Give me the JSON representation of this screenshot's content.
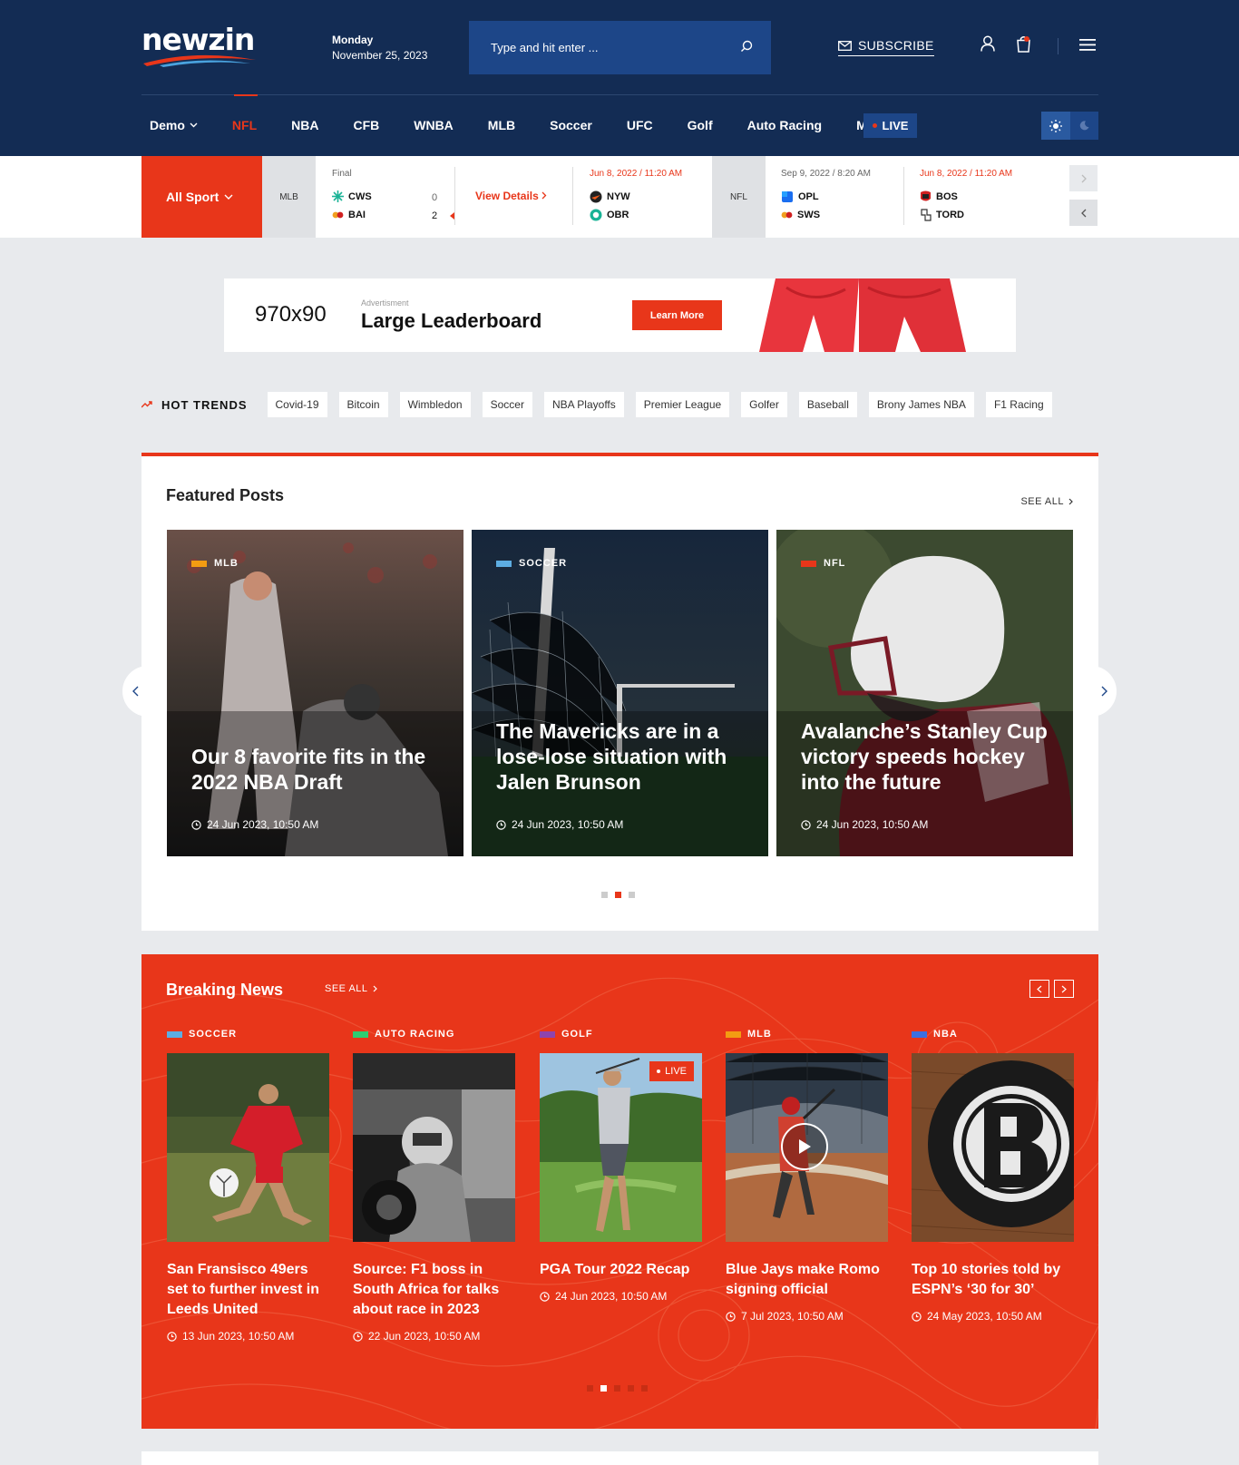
{
  "header": {
    "logo": "newzin",
    "date_day": "Monday",
    "date_full": "November 25, 2023",
    "search_placeholder": "Type and hit enter ...",
    "subscribe": "SUBSCRIBE",
    "nav": [
      {
        "label": "Demo",
        "dropdown": true
      },
      {
        "label": "NFL",
        "active": true
      },
      {
        "label": "NBA"
      },
      {
        "label": "CFB"
      },
      {
        "label": "WNBA"
      },
      {
        "label": "MLB"
      },
      {
        "label": "Soccer"
      },
      {
        "label": "UFC"
      },
      {
        "label": "Golf"
      },
      {
        "label": "Auto Racing"
      },
      {
        "label": "More"
      }
    ],
    "live": "LIVE"
  },
  "scores": {
    "all_sport": "All Sport",
    "league1": "MLB",
    "game1_status": "Final",
    "game1_team1": "CWS",
    "game1_score1": "0",
    "game1_team2": "BAI",
    "game1_score2": "2",
    "view_details": "View Details",
    "game2_time": "Jun 8, 2022 / 11:20 AM",
    "game2_team1": "NYW",
    "game2_team2": "OBR",
    "league2": "NFL",
    "game3_time": "Sep 9, 2022 / 8:20 AM",
    "game3_team1": "OPL",
    "game3_team2": "SWS",
    "game4_time": "Jun 8, 2022 / 11:20 AM",
    "game4_team1": "BOS",
    "game4_team2": "TORD"
  },
  "ad": {
    "size": "970x90",
    "label": "Advertisment",
    "title": "Large Leaderboard",
    "button": "Learn More"
  },
  "trends": {
    "label": "HOT TRENDS",
    "tags": [
      "Covid-19",
      "Bitcoin",
      "Wimbledon",
      "Soccer",
      "NBA Playoffs",
      "Premier League",
      "Golfer",
      "Baseball",
      "Brony James NBA",
      "F1 Racing"
    ]
  },
  "featured": {
    "title": "Featured Posts",
    "see_all": "SEE ALL",
    "cards": [
      {
        "cat": "MLB",
        "title": "Our 8 favorite fits in the 2022 NBA Draft",
        "date": "24 Jun 2023, 10:50 AM"
      },
      {
        "cat": "SOCCER",
        "title": "The Mavericks are in a lose-lose situation with Jalen Brunson",
        "date": "24 Jun 2023, 10:50 AM"
      },
      {
        "cat": "NFL",
        "title": "Avalanche’s Stanley Cup victory speeds hockey into the future",
        "date": "24 Jun 2023, 10:50 AM"
      }
    ]
  },
  "breaking": {
    "title": "Breaking News",
    "see_all": "SEE ALL",
    "live": "LIVE",
    "cards": [
      {
        "cat": "SOCCER",
        "title": "San Fransisco 49ers set to further invest in Leeds United",
        "date": "13 Jun 2023, 10:50 AM"
      },
      {
        "cat": "AUTO RACING",
        "title": "Source: F1 boss in South Africa for talks about race in 2023",
        "date": "22 Jun 2023, 10:50 AM"
      },
      {
        "cat": "GOLF",
        "title": "PGA Tour 2022 Recap",
        "date": "24 Jun 2023, 10:50 AM"
      },
      {
        "cat": "MLB",
        "title": "Blue Jays make Romo signing official",
        "date": "7 Jul 2023, 10:50 AM"
      },
      {
        "cat": "NBA",
        "title": "Top 10 stories told by ESPN’s ‘30 for 30’",
        "date": "24 May 2023, 10:50 AM"
      }
    ]
  },
  "colors": {
    "navy": "#132c54",
    "accent": "#e8361a",
    "search_bg": "#1d4688"
  },
  "icons": [
    "search-icon",
    "mail-icon",
    "user-icon",
    "cart-icon",
    "menu-icon",
    "sun-icon",
    "moon-icon",
    "clock-icon",
    "trend-icon",
    "play-icon"
  ]
}
